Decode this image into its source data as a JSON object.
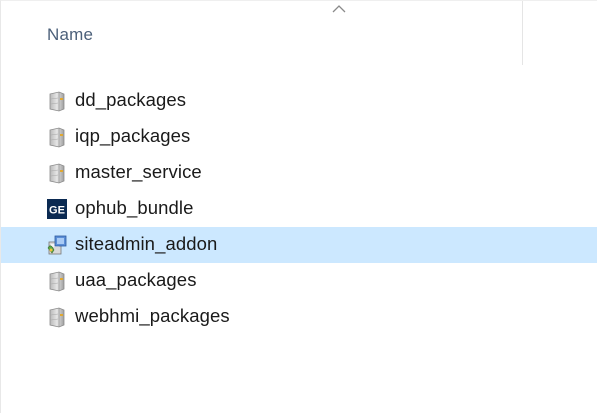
{
  "header": {
    "name_column": "Name",
    "sort_icon": "chevron-up-icon"
  },
  "files": [
    {
      "name": "dd_packages",
      "icon": "file-cabinet-icon",
      "selected": false
    },
    {
      "name": "iqp_packages",
      "icon": "file-cabinet-icon",
      "selected": false
    },
    {
      "name": "master_service",
      "icon": "file-cabinet-icon",
      "selected": false
    },
    {
      "name": "ophub_bundle",
      "icon": "ge-logo-icon",
      "selected": false
    },
    {
      "name": "siteadmin_addon",
      "icon": "installer-icon",
      "selected": true
    },
    {
      "name": "uaa_packages",
      "icon": "file-cabinet-icon",
      "selected": false
    },
    {
      "name": "webhmi_packages",
      "icon": "file-cabinet-icon",
      "selected": false
    }
  ],
  "colors": {
    "selection": "#cce8ff",
    "header_text": "#4c607a"
  }
}
